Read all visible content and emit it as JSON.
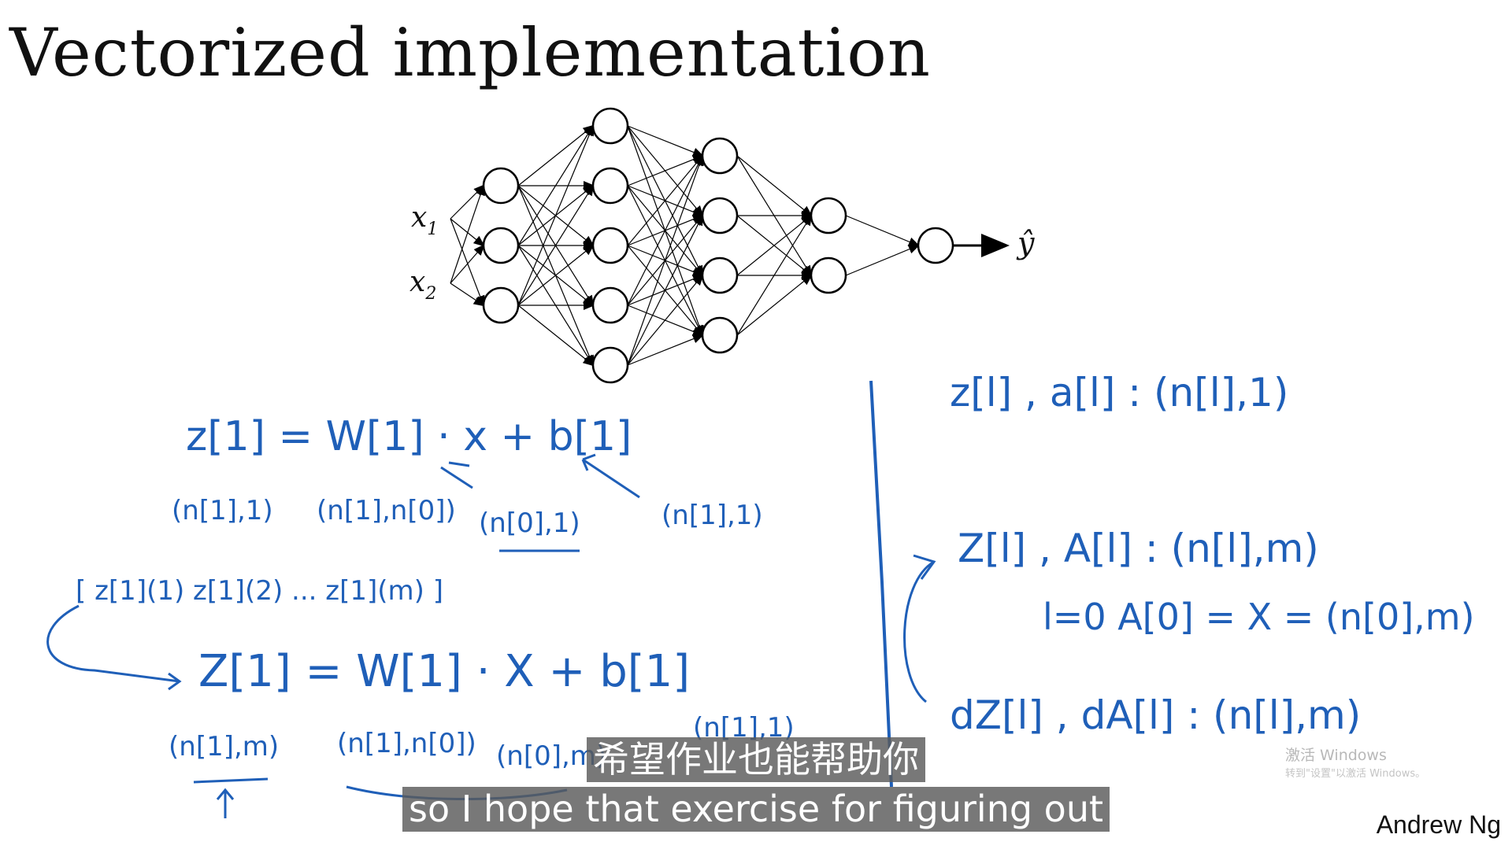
{
  "slide": {
    "title": "Vectorized implementation",
    "author": "Andrew Ng"
  },
  "network": {
    "inputs": [
      "x",
      "x"
    ],
    "input_subscripts": [
      "1",
      "2"
    ],
    "output": "ŷ",
    "layer_sizes": [
      3,
      5,
      4,
      2,
      1
    ]
  },
  "handwriting": {
    "eq1": "z[1] = W[1] · x + b[1]",
    "eq1_dims": [
      "(n[1],1)",
      "(n[1],n[0])",
      "(n[0],1)",
      "(n[1],1)"
    ],
    "stack": "[ z[1](1)  z[1](2)  ...  z[1](m) ]",
    "eq2": "Z[1] = W[1] · X + b[1]",
    "eq2_dims": [
      "(n[1],m)",
      "(n[1],n[0])",
      "(n[0],m)",
      "(n[1],1)"
    ],
    "right1": "z[l] , a[l] : (n[l],1)",
    "right2": "Z[l] , A[l] : (n[l],m)",
    "right3": "l=0    A[0] = X = (n[0],m)",
    "right4": "dZ[l] , dA[l] : (n[l],m)"
  },
  "subtitles": {
    "zh": "希望作业也能帮助你",
    "en": "so I hope that exercise for figuring out"
  },
  "watermark": {
    "title": "激活 Windows",
    "subtitle": "转到\"设置\"以激活 Windows。"
  },
  "colors": {
    "ink": "#1f5fb8",
    "subtitle_bg": "#5a5a5a"
  }
}
